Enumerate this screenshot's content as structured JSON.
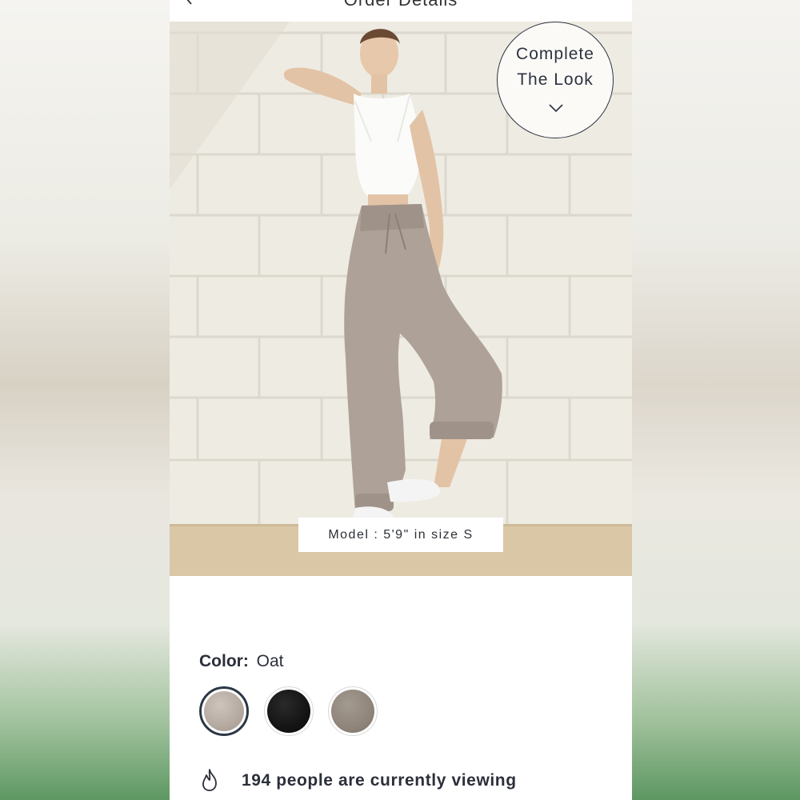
{
  "header": {
    "title": "Order Details"
  },
  "product": {
    "badge_line1": "Complete",
    "badge_line2": "The Look",
    "model_info": "Model : 5'9\" in size S"
  },
  "color": {
    "label": "Color:",
    "value": "Oat",
    "swatches": [
      {
        "name": "Oat",
        "hex": "#b7aca3",
        "selected": true
      },
      {
        "name": "Black",
        "hex": "#141414",
        "selected": false
      },
      {
        "name": "Taupe",
        "hex": "#8f857a",
        "selected": false
      }
    ]
  },
  "social_proof": {
    "icon": "flame-icon",
    "text": "194 people are currently viewing"
  }
}
